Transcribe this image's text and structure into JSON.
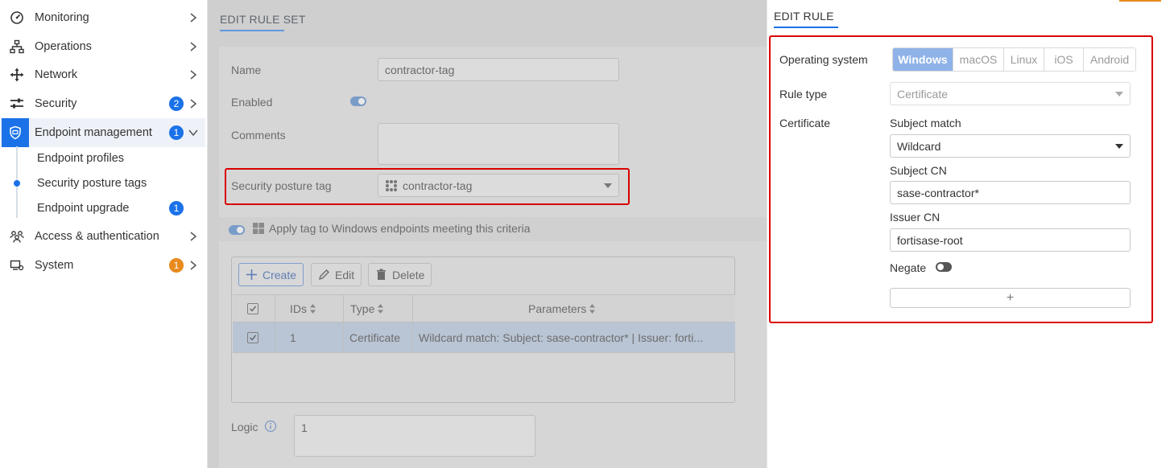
{
  "sidebar": {
    "items": [
      {
        "label": "Monitoring",
        "icon": "gauge-icon"
      },
      {
        "label": "Operations",
        "icon": "hierarchy-icon"
      },
      {
        "label": "Network",
        "icon": "move-arrows-icon"
      },
      {
        "label": "Security",
        "icon": "sliders-icon",
        "badge": "2"
      },
      {
        "label": "Endpoint management",
        "icon": "shield-icon",
        "badge": "1"
      },
      {
        "label": "Access & authentication",
        "icon": "users-icon"
      },
      {
        "label": "System",
        "icon": "system-icon",
        "badge": "1"
      }
    ],
    "sub_items": [
      {
        "label": "Endpoint profiles"
      },
      {
        "label": "Security posture tags"
      },
      {
        "label": "Endpoint upgrade",
        "badge": "1"
      }
    ]
  },
  "main": {
    "title": "EDIT RULE SET",
    "name_label": "Name",
    "name_value": "contractor-tag",
    "enabled_label": "Enabled",
    "comments_label": "Comments",
    "tag_label": "Security posture tag",
    "tag_value": "contractor-tag",
    "apply_text": "Apply tag to Windows endpoints meeting this criteria",
    "toolbar": {
      "create": "Create",
      "edit": "Edit",
      "delete": "Delete"
    },
    "table": {
      "columns": [
        "IDs",
        "Type",
        "Parameters"
      ],
      "rows": [
        {
          "id": "1",
          "type": "Certificate",
          "parameters": "Wildcard match: Subject: sase-contractor* | Issuer: forti..."
        }
      ]
    },
    "logic_label": "Logic",
    "logic_value": "1"
  },
  "panel": {
    "title": "EDIT RULE",
    "os_label": "Operating system",
    "os_options": [
      "Windows",
      "macOS",
      "Linux",
      "iOS",
      "Android"
    ],
    "os_selected": "Windows",
    "rule_type_label": "Rule type",
    "rule_type_value": "Certificate",
    "certificate_label": "Certificate",
    "subject_match_label": "Subject match",
    "subject_match_value": "Wildcard",
    "subject_cn_label": "Subject CN",
    "subject_cn_value": "sase-contractor*",
    "issuer_cn_label": "Issuer CN",
    "issuer_cn_value": "fortisase-root",
    "negate_label": "Negate",
    "add_label": "+"
  },
  "colors": {
    "accent": "#1b72e8",
    "highlight": "#d90000",
    "badge_orange": "#e88a1d"
  }
}
